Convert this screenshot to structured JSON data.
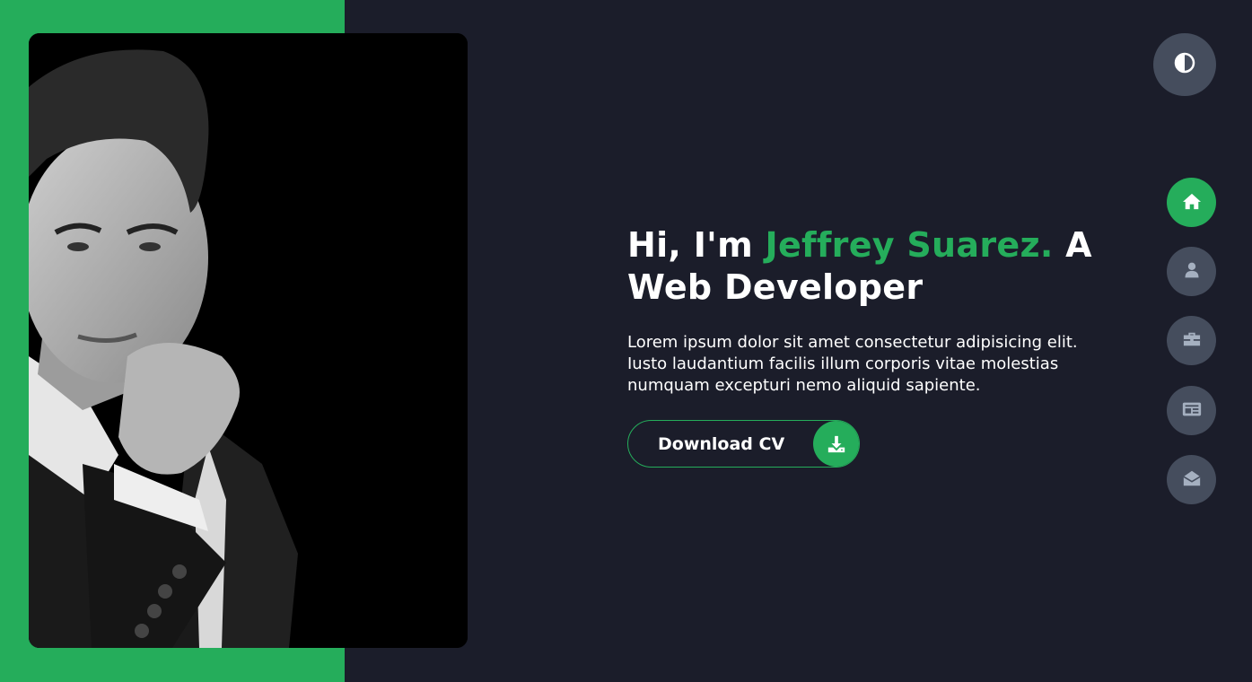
{
  "hero": {
    "greeting": "Hi, I'm ",
    "name": "Jeffrey Suarez.",
    "role": " A Web Developer",
    "intro": "Lorem ipsum dolor sit amet consectetur adipisicing elit. Iusto laudantium facilis illum corporis vitae molestias numquam excepturi nemo aliquid sapiente.",
    "cv_button_label": "Download CV",
    "cv_icon": "download-icon"
  },
  "theme_toggle": {
    "icon": "contrast-icon"
  },
  "nav": {
    "active": "home",
    "items": [
      {
        "id": "home",
        "icon": "home-icon"
      },
      {
        "id": "about",
        "icon": "user-icon"
      },
      {
        "id": "portfolio",
        "icon": "briefcase-icon"
      },
      {
        "id": "blog",
        "icon": "newspaper-icon"
      },
      {
        "id": "contact",
        "icon": "envelope-open-icon"
      }
    ]
  },
  "colors": {
    "accent": "#25ad5b",
    "background": "#1b1d2a",
    "button_gray": "#454d5d",
    "icon_gray": "#a5b0c0"
  }
}
